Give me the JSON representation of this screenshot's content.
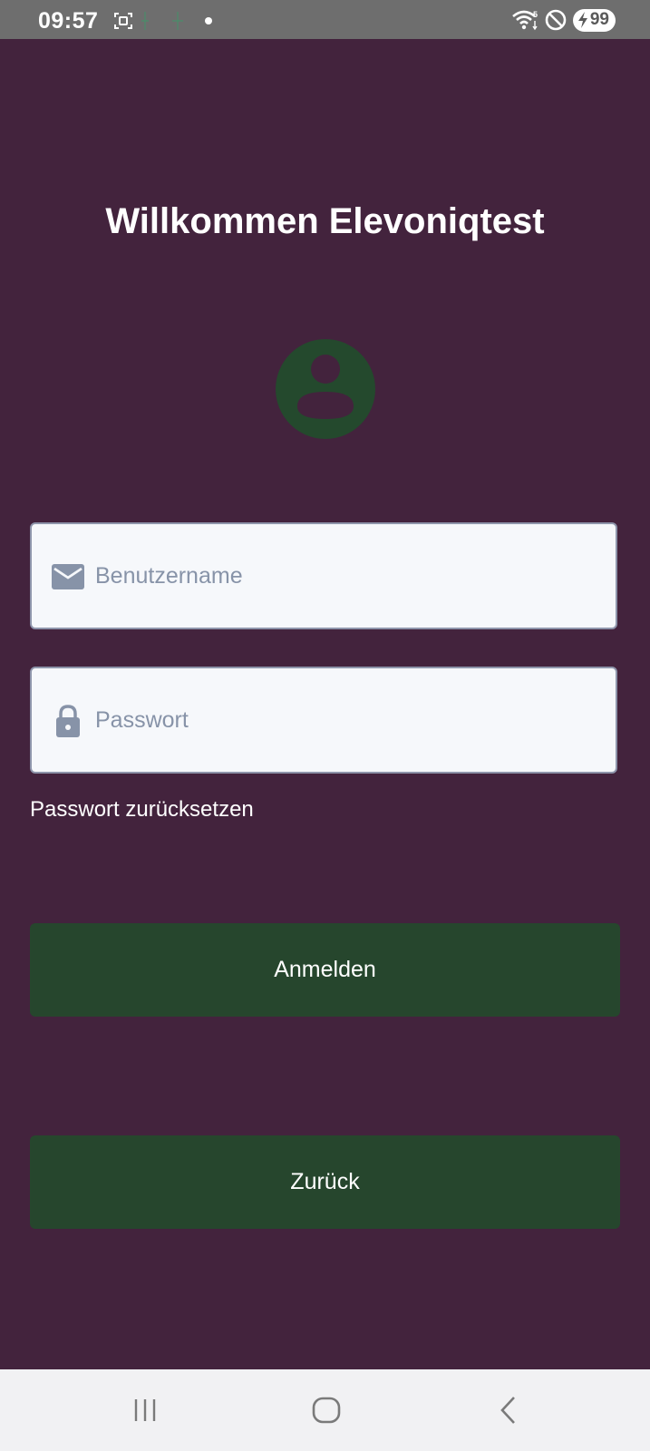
{
  "status_bar": {
    "time": "09:57",
    "battery": "99"
  },
  "screen": {
    "title": "Willkommen Elevoniqtest",
    "avatar_icon": "account-circle-icon",
    "username": {
      "placeholder": "Benutzername",
      "value": "",
      "icon": "mail-icon"
    },
    "password": {
      "placeholder": "Passwort",
      "value": "",
      "icon": "lock-icon"
    },
    "reset_link": "Passwort zurücksetzen",
    "login_button": "Anmelden",
    "back_button": "Zurück"
  },
  "colors": {
    "background": "#43233d",
    "button": "#26462d",
    "avatar": "#24492d",
    "input_background": "#f6f8fb",
    "input_icon": "#8793a8"
  }
}
